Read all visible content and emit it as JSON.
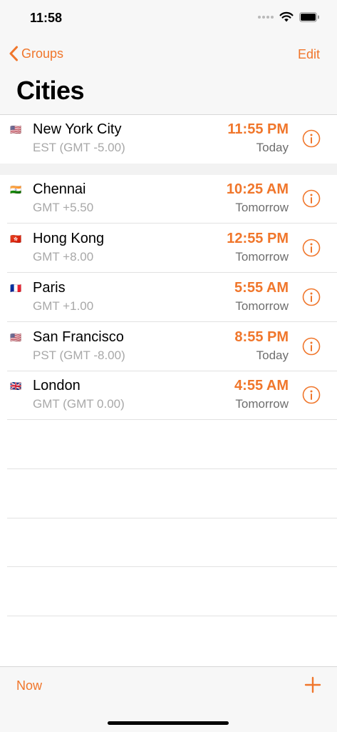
{
  "status": {
    "time": "11:58"
  },
  "nav": {
    "back_label": "Groups",
    "edit_label": "Edit",
    "title": "Cities"
  },
  "cities": [
    {
      "flag": "🇺🇸",
      "flag_icon": "us-flag-icon",
      "name": "New York City",
      "tz": "EST (GMT -5.00)",
      "time": "11:55 PM",
      "day": "Today"
    },
    {
      "flag": "🇮🇳",
      "flag_icon": "india-flag-icon",
      "name": "Chennai",
      "tz": "GMT +5.50",
      "time": "10:25 AM",
      "day": "Tomorrow"
    },
    {
      "flag": "🇭🇰",
      "flag_icon": "hong-kong-flag-icon",
      "name": "Hong Kong",
      "tz": "GMT +8.00",
      "time": "12:55 PM",
      "day": "Tomorrow"
    },
    {
      "flag": "🇫🇷",
      "flag_icon": "france-flag-icon",
      "name": "Paris",
      "tz": "GMT +1.00",
      "time": "5:55 AM",
      "day": "Tomorrow"
    },
    {
      "flag": "🇺🇸",
      "flag_icon": "us-flag-icon",
      "name": "San Francisco",
      "tz": "PST (GMT -8.00)",
      "time": "8:55 PM",
      "day": "Today"
    },
    {
      "flag": "🇬🇧",
      "flag_icon": "uk-flag-icon",
      "name": "London",
      "tz": "GMT (GMT 0.00)",
      "time": "4:55 AM",
      "day": "Tomorrow"
    }
  ],
  "toolbar": {
    "now_label": "Now",
    "add_icon": "plus-icon"
  },
  "colors": {
    "accent": "#f0762b",
    "secondary_text": "#a8a8a8",
    "day_text": "#6e6e6e"
  }
}
